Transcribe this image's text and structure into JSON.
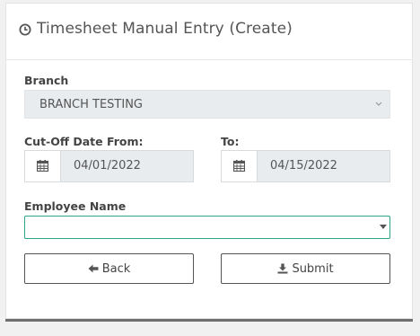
{
  "header": {
    "title": "Timesheet Manual Entry (Create)",
    "icon": "clock-icon"
  },
  "form": {
    "branch": {
      "label": "Branch",
      "value": "BRANCH TESTING"
    },
    "cutoff_from": {
      "label": "Cut-Off Date From:",
      "value": "04/01/2022"
    },
    "cutoff_to": {
      "label": "To:",
      "value": "04/15/2022"
    },
    "employee": {
      "label": "Employee Name",
      "value": ""
    }
  },
  "actions": {
    "back_label": "Back",
    "submit_label": "Submit"
  },
  "colors": {
    "focus_border": "#2aa58a",
    "readonly_bg": "#e9ecef"
  }
}
